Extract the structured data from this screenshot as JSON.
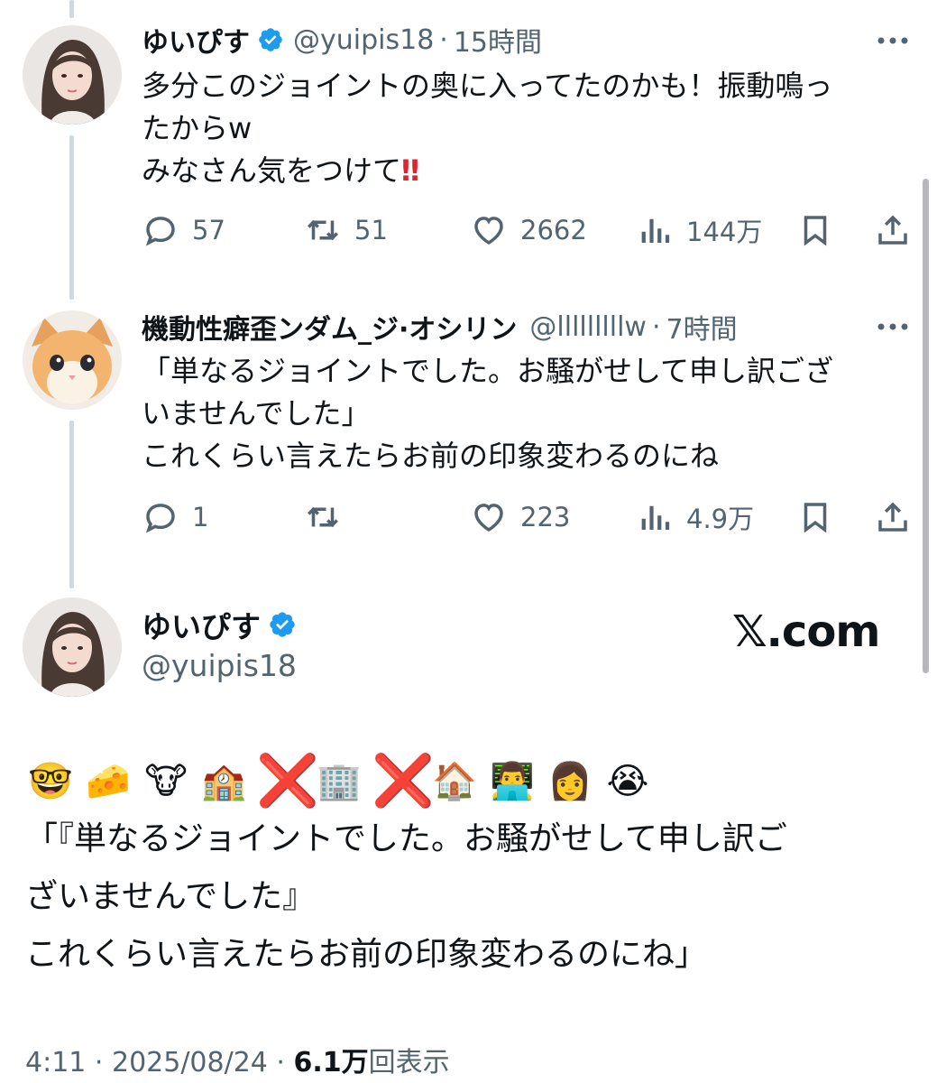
{
  "tweet1": {
    "name": "ゆいぴす",
    "handle": "@yuipis18",
    "time": "15時間",
    "lines": [
      "多分このジョイントの奥に入ってたのかも！振動鳴っ",
      "たからw",
      "みなさん気をつけて"
    ],
    "emphasis": "‼",
    "replies": "57",
    "reposts": "51",
    "likes": "2662",
    "views": "144万"
  },
  "tweet2": {
    "name": "機動性癖歪ンダム_ジ·オシリン",
    "handle": "@lllllllllw",
    "time": "7時間",
    "lines": [
      "「単なるジョイントでした。お騒がせして申し訳ござ",
      "いませんでした」",
      "これくらい言えたらお前の印象変わるのにね"
    ],
    "replies": "1",
    "reposts": "",
    "likes": "223",
    "views": "4.9万"
  },
  "main": {
    "name": "ゆいぴす",
    "handle": "@yuipis18",
    "site": "𝕏.com",
    "emojis": [
      "🤓",
      "🧀",
      "🐮",
      "🏫",
      "❌",
      "🏢",
      "❌",
      "🏠",
      "👨‍💻",
      "👩",
      "😭"
    ],
    "lines": [
      "「『単なるジョイントでした。お騒がせして申し訳ご",
      "ざいませんでした』",
      "これくらい言えたらお前の印象変わるのにね」"
    ],
    "timestamp": "4:11 · 2025/08/24 · ",
    "view_count": "6.1万",
    "view_label": "回表示"
  },
  "colors": {
    "verified": "#1d9bf0",
    "muted": "#536471",
    "text": "#0f1419",
    "thread": "#cfd9de"
  },
  "icons": [
    "reply-icon",
    "repost-icon",
    "like-icon",
    "views-icon",
    "bookmark-icon",
    "share-icon",
    "verified-badge-icon",
    "more-icon"
  ]
}
